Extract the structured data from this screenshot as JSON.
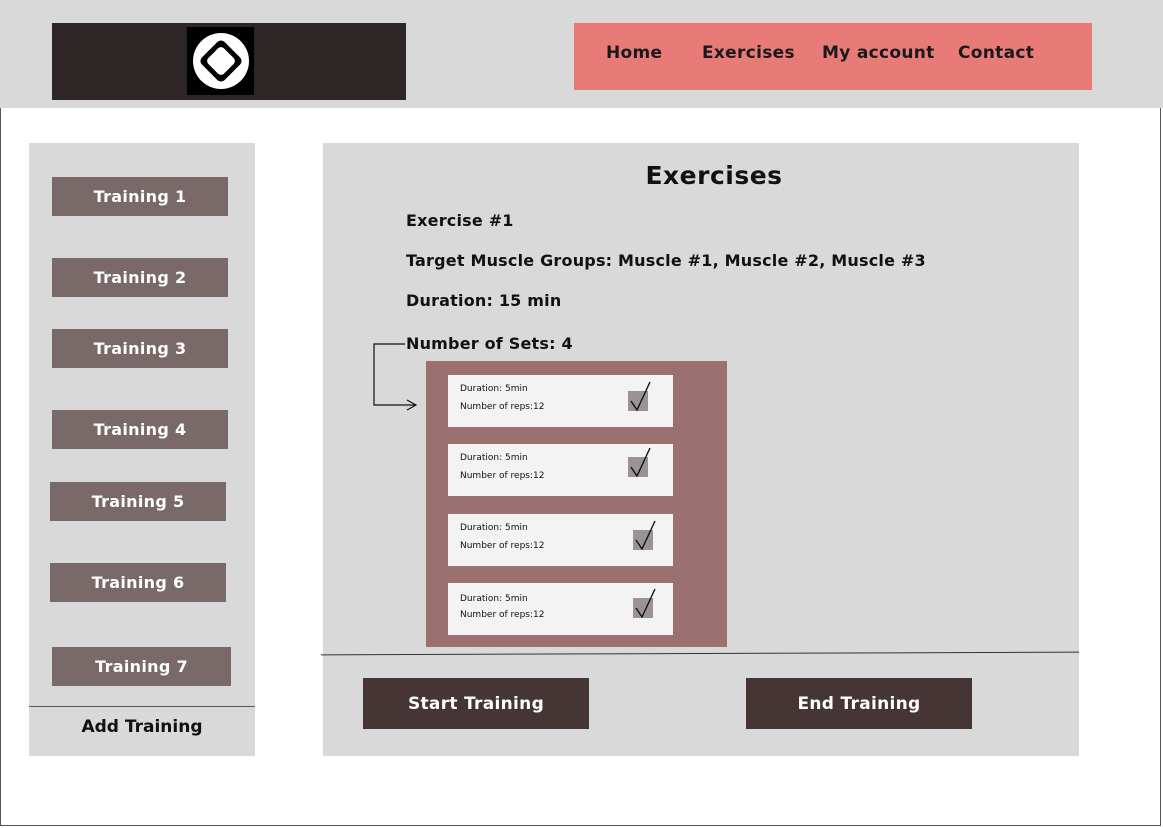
{
  "header": {
    "logo_icon": "diamond-logo-icon",
    "nav": [
      {
        "label": "Home"
      },
      {
        "label": "Exercises"
      },
      {
        "label": "My account"
      },
      {
        "label": "Contact"
      }
    ],
    "colors": {
      "nav_bg": "#e87a78",
      "logo_bg": "#2e2626"
    }
  },
  "sidebar": {
    "trainings": [
      {
        "label": "Training 1"
      },
      {
        "label": "Training 2"
      },
      {
        "label": "Training 3"
      },
      {
        "label": "Training 4"
      },
      {
        "label": "Training 5"
      },
      {
        "label": "Training 6"
      },
      {
        "label": "Training 7"
      }
    ],
    "add_label": "Add Training"
  },
  "main": {
    "title": "Exercises",
    "exercise_name": "Exercise #1",
    "muscle_groups": "Target Muscle Groups: Muscle #1, Muscle #2, Muscle #3",
    "duration": "Duration: 15 min",
    "sets_label": "Number of Sets: 4",
    "sets": [
      {
        "duration": "Duration: 5min",
        "reps": "Number of reps:12",
        "checked": true
      },
      {
        "duration": "Duration: 5min",
        "reps": "Number of reps:12",
        "checked": true
      },
      {
        "duration": "Duration: 5min",
        "reps": "Number of reps:12",
        "checked": true
      },
      {
        "duration": "Duration: 5min",
        "reps": "Number of reps:12",
        "checked": true
      }
    ],
    "start_label": "Start Training",
    "end_label": "End Training"
  }
}
